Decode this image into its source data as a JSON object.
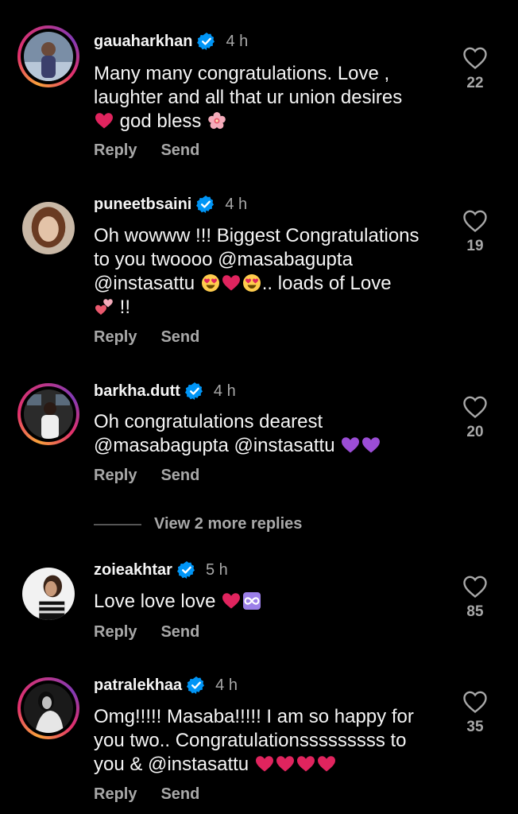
{
  "comments": [
    {
      "username": "gauaharkhan",
      "time": "4 h",
      "text_lines": [
        "Many many congratulations. Love ,",
        "laughter and all that ur union desires",
        "god bless"
      ],
      "likes": "22",
      "reply": "Reply",
      "send": "Send",
      "story_ring": true
    },
    {
      "username": "puneetbsaini",
      "time": "4 h",
      "text_lines": [
        "Oh wowww !!! Biggest Congratulations",
        "to you twoooo @masabagupta",
        "@instasattu",
        ".. loads of Love",
        "!!"
      ],
      "likes": "19",
      "reply": "Reply",
      "send": "Send",
      "story_ring": false
    },
    {
      "username": "barkha.dutt",
      "time": "4 h",
      "text_lines": [
        "Oh congratulations dearest",
        "@masabagupta @instasattu"
      ],
      "likes": "20",
      "reply": "Reply",
      "send": "Send",
      "story_ring": true
    },
    {
      "username": "zoieakhtar",
      "time": "5 h",
      "text_lines": [
        "Love love love"
      ],
      "likes": "85",
      "reply": "Reply",
      "send": "Send",
      "story_ring": false
    },
    {
      "username": "patralekhaa",
      "time": "4 h",
      "text_lines": [
        "Omg!!!!! Masaba!!!!! I am so happy for",
        "you two.. Congratulationsssssssss to",
        "you & @instasattu"
      ],
      "likes": "35",
      "reply": "Reply",
      "send": "Send",
      "story_ring": true
    }
  ],
  "view_more_replies": "View 2 more replies",
  "colors": {
    "verified": "#0095f6",
    "heart": "#e0245e",
    "purple_heart": "#9b4dd6",
    "muted": "#a8a8a8"
  }
}
